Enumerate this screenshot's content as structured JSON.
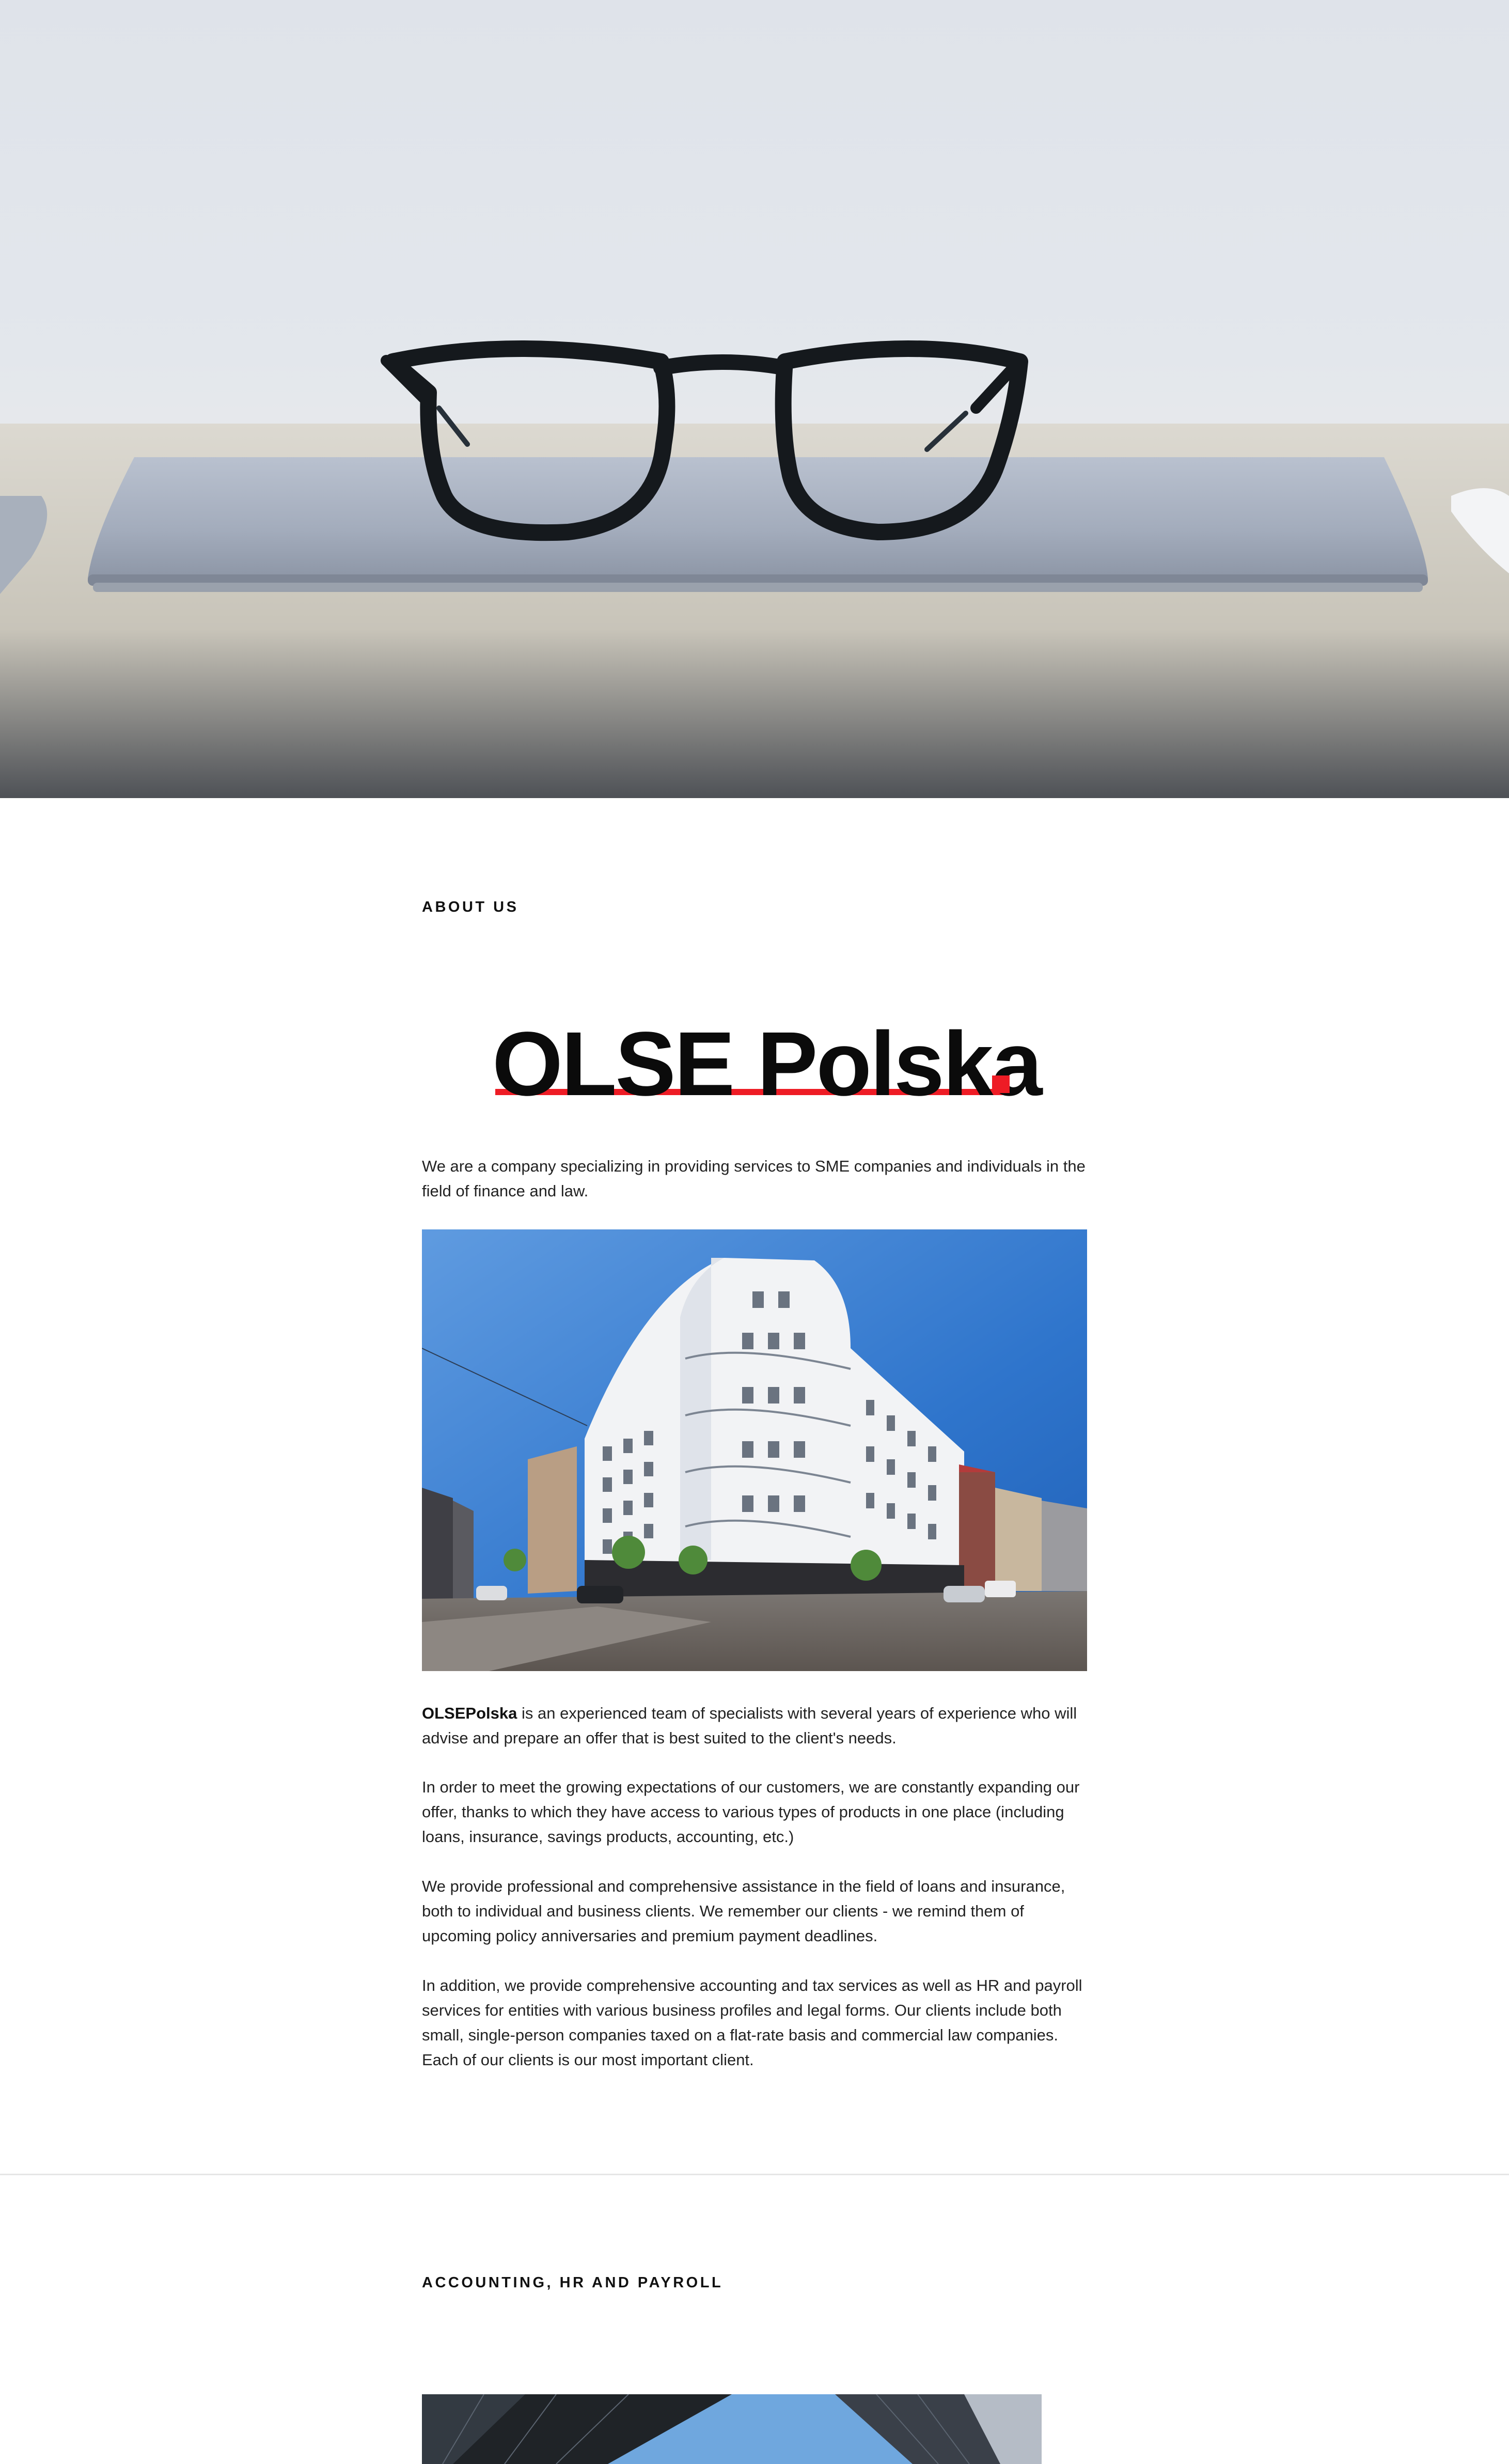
{
  "about": {
    "label": "ABOUT US",
    "brand_name": "OLSE Polska",
    "intro": "We are a company specializing in providing services to SME companies and individuals in the field of finance and law.",
    "p1_strong": "OLSEPolska",
    "p1_rest": " is an experienced team of specialists with several years of experience who will advise and prepare an offer that is best suited to the client's needs.",
    "p2": "In order to meet the growing expectations of our customers, we are constantly expanding our offer, thanks to which they have access to various types of products in one place (including loans, insurance, savings products, accounting, etc.)",
    "p3": "We provide professional and comprehensive assistance in the field of loans and insurance, both to individual and business clients. We remember our clients - we remind them of upcoming policy anniversaries and premium payment deadlines.",
    "p4": "In addition, we provide comprehensive accounting and tax services as well as HR and payroll services for entities with various business profiles and legal forms. Our clients include both small, single-person companies taxed on a flat-rate basis and commercial law companies. Each of our clients is our most important client."
  },
  "accounting": {
    "label": "ACCOUNTING, HR AND PAYROLL"
  },
  "colors": {
    "accent": "#ee1c25",
    "text": "#222222",
    "heading": "#111111"
  }
}
